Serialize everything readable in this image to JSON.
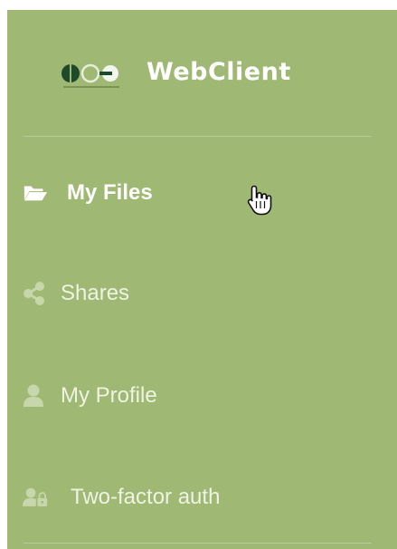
{
  "brand": {
    "title": "WebClient",
    "logo_icon": "company-logo"
  },
  "nav": {
    "items": [
      {
        "label": "My Files",
        "icon": "folder-open-icon",
        "active": true
      },
      {
        "label": "Shares",
        "icon": "share-icon",
        "active": false
      },
      {
        "label": "My Profile",
        "icon": "user-icon",
        "active": false
      },
      {
        "label": "Two-factor auth",
        "icon": "user-lock-icon",
        "active": false
      }
    ]
  },
  "colors": {
    "sidebar_bg": "#9fb873",
    "active_text": "#ffffff",
    "inactive_text": "#eef3e4",
    "inactive_icon": "#c8d7ab",
    "logo_dark": "#1e4a2b"
  },
  "cursor": {
    "icon": "hand-pointer-cursor-icon"
  }
}
